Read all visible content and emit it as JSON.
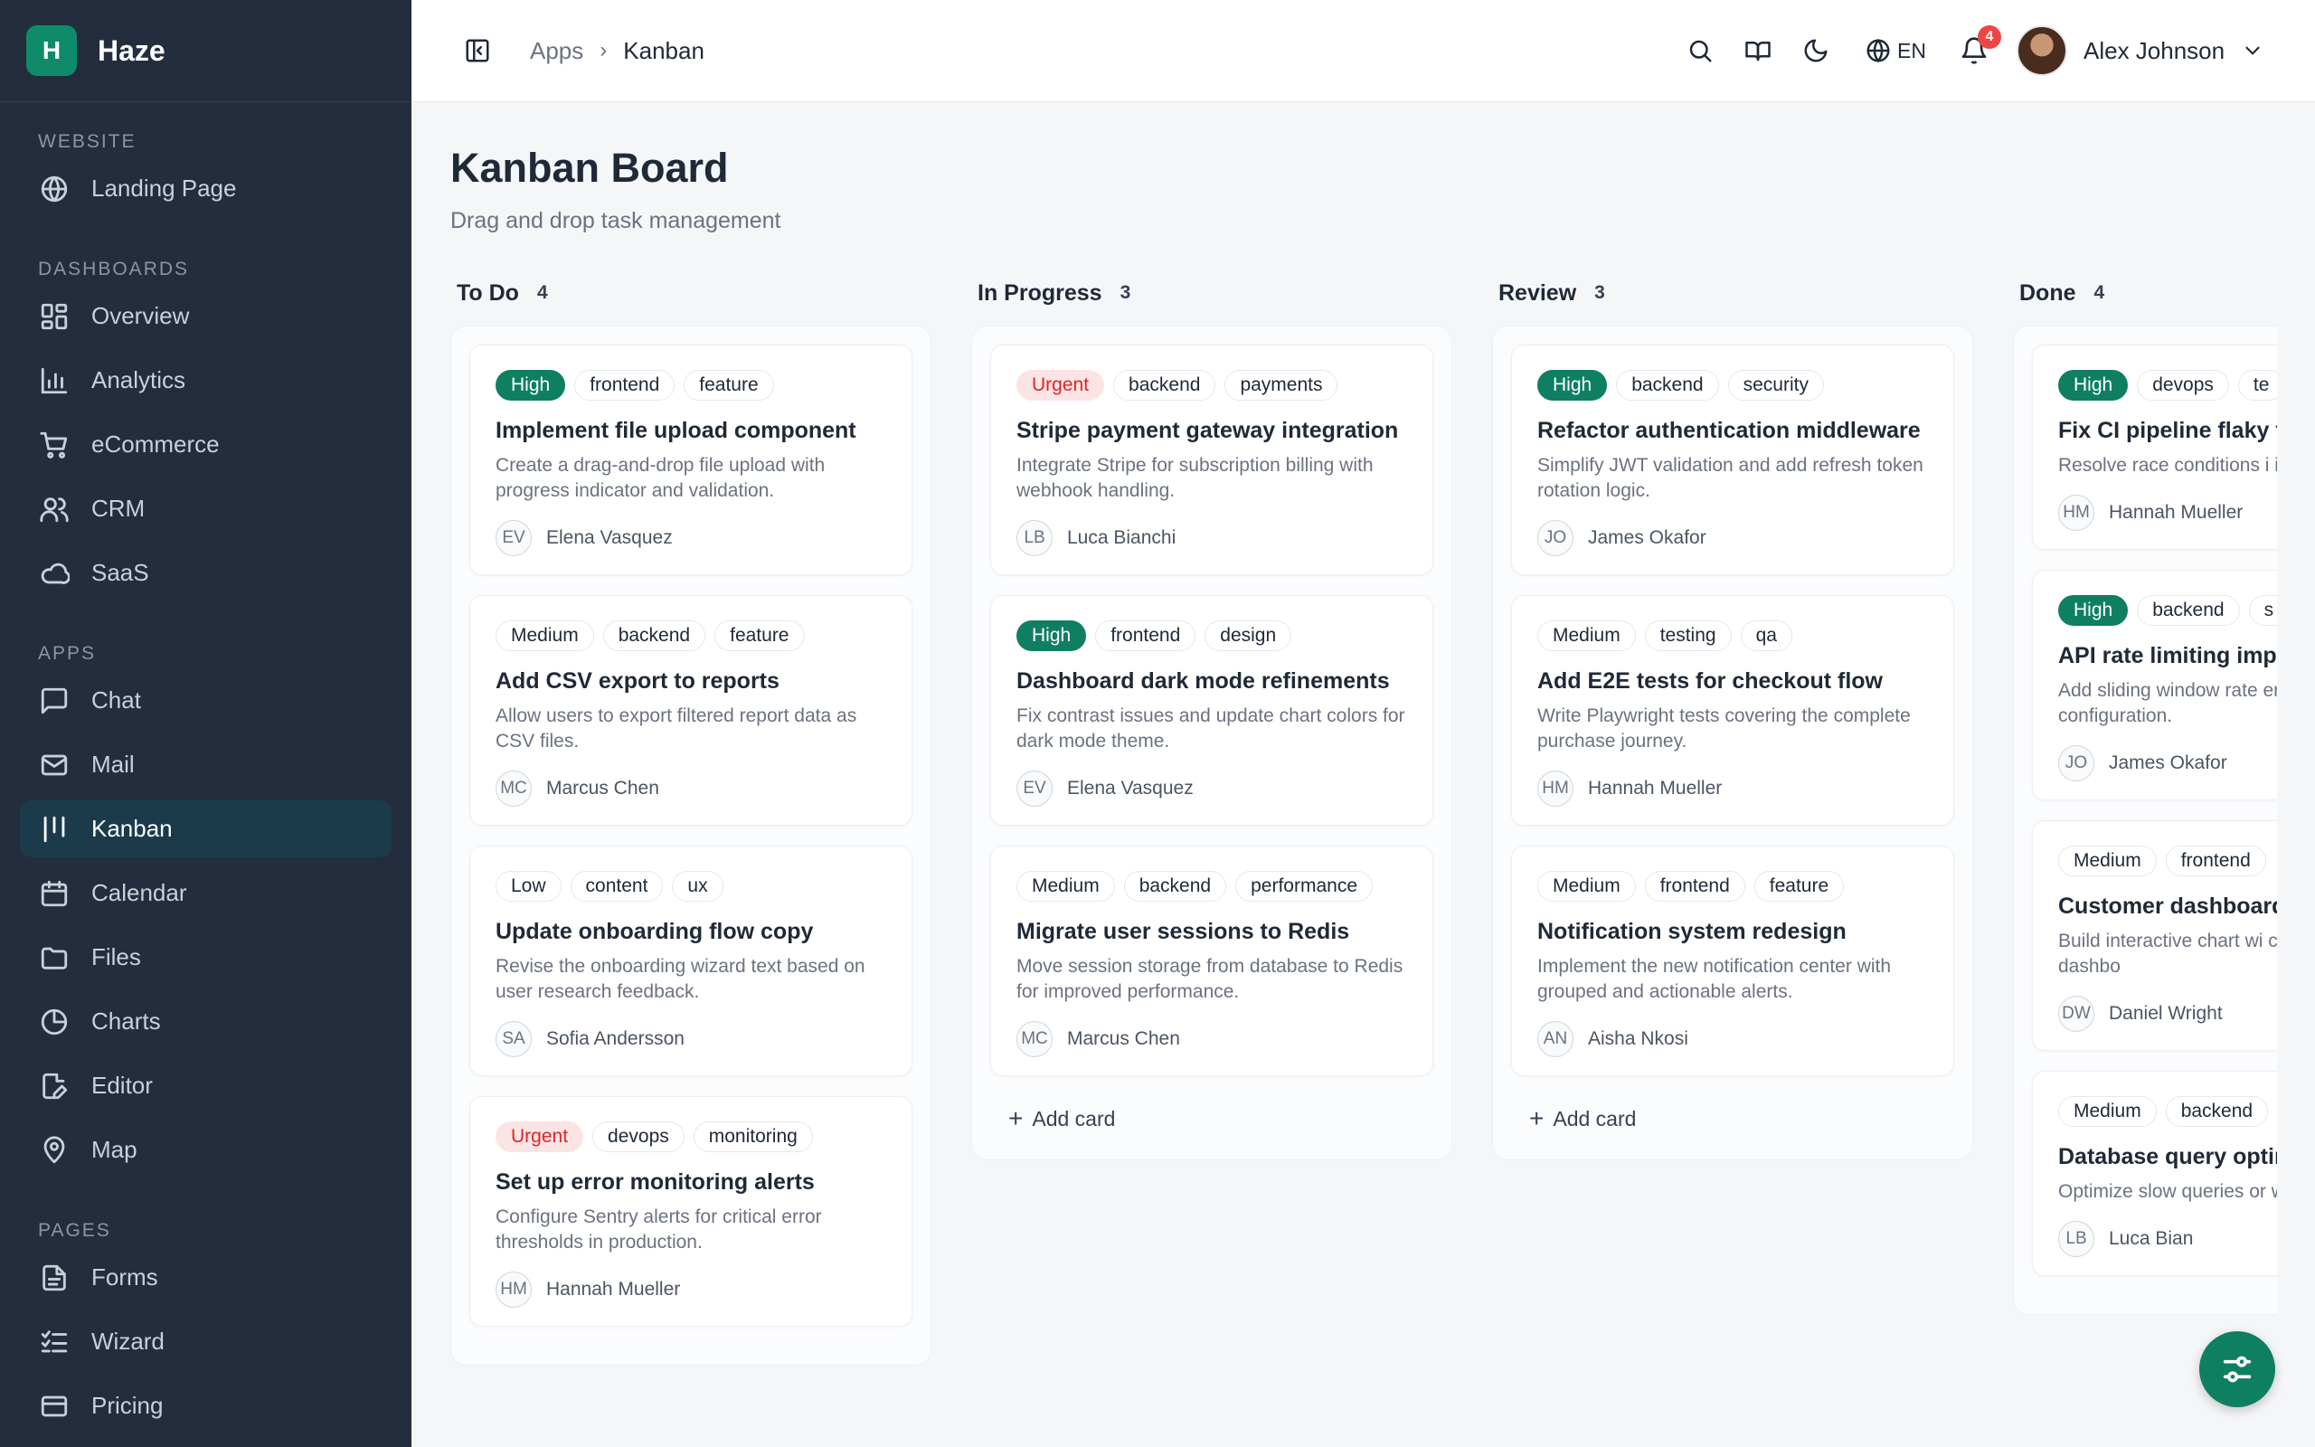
{
  "brand": {
    "logo": "H",
    "name": "Haze"
  },
  "sidebar": {
    "sections": [
      {
        "title": "WEBSITE",
        "items": [
          {
            "label": "Landing Page",
            "icon": "globe-icon"
          }
        ]
      },
      {
        "title": "DASHBOARDS",
        "items": [
          {
            "label": "Overview",
            "icon": "grid-icon"
          },
          {
            "label": "Analytics",
            "icon": "bar-chart-icon"
          },
          {
            "label": "eCommerce",
            "icon": "cart-icon"
          },
          {
            "label": "CRM",
            "icon": "users-icon"
          },
          {
            "label": "SaaS",
            "icon": "cloud-icon"
          }
        ]
      },
      {
        "title": "APPS",
        "items": [
          {
            "label": "Chat",
            "icon": "chat-icon"
          },
          {
            "label": "Mail",
            "icon": "mail-icon"
          },
          {
            "label": "Kanban",
            "icon": "kanban-icon",
            "active": true
          },
          {
            "label": "Calendar",
            "icon": "calendar-icon"
          },
          {
            "label": "Files",
            "icon": "folder-icon"
          },
          {
            "label": "Charts",
            "icon": "pie-chart-icon"
          },
          {
            "label": "Editor",
            "icon": "edit-icon"
          },
          {
            "label": "Map",
            "icon": "map-pin-icon"
          }
        ]
      },
      {
        "title": "PAGES",
        "items": [
          {
            "label": "Forms",
            "icon": "file-text-icon"
          },
          {
            "label": "Wizard",
            "icon": "checklist-icon"
          },
          {
            "label": "Pricing",
            "icon": "credit-card-icon"
          }
        ]
      }
    ]
  },
  "header": {
    "breadcrumb": {
      "root": "Apps",
      "current": "Kanban"
    },
    "language": "EN",
    "notifications_count": "4",
    "user_name": "Alex Johnson"
  },
  "page": {
    "title": "Kanban Board",
    "subtitle": "Drag and drop task management"
  },
  "board": {
    "add_card_label": "Add card",
    "columns": [
      {
        "title": "To Do",
        "count": "4",
        "cards": [
          {
            "tags": [
              "High",
              "frontend",
              "feature"
            ],
            "title": "Implement file upload component",
            "desc": "Create a drag-and-drop file upload with progress indicator and validation.",
            "initials": "EV",
            "assignee": "Elena Vasquez"
          },
          {
            "tags": [
              "Medium",
              "backend",
              "feature"
            ],
            "title": "Add CSV export to reports",
            "desc": "Allow users to export filtered report data as CSV files.",
            "initials": "MC",
            "assignee": "Marcus Chen"
          },
          {
            "tags": [
              "Low",
              "content",
              "ux"
            ],
            "title": "Update onboarding flow copy",
            "desc": "Revise the onboarding wizard text based on user research feedback.",
            "initials": "SA",
            "assignee": "Sofia Andersson"
          },
          {
            "tags": [
              "Urgent",
              "devops",
              "monitoring"
            ],
            "title": "Set up error monitoring alerts",
            "desc": "Configure Sentry alerts for critical error thresholds in production.",
            "initials": "HM",
            "assignee": "Hannah Mueller"
          }
        ]
      },
      {
        "title": "In Progress",
        "count": "3",
        "cards": [
          {
            "tags": [
              "Urgent",
              "backend",
              "payments"
            ],
            "title": "Stripe payment gateway integration",
            "desc": "Integrate Stripe for subscription billing with webhook handling.",
            "initials": "LB",
            "assignee": "Luca Bianchi"
          },
          {
            "tags": [
              "High",
              "frontend",
              "design"
            ],
            "title": "Dashboard dark mode refinements",
            "desc": "Fix contrast issues and update chart colors for dark mode theme.",
            "initials": "EV",
            "assignee": "Elena Vasquez"
          },
          {
            "tags": [
              "Medium",
              "backend",
              "performance"
            ],
            "title": "Migrate user sessions to Redis",
            "desc": "Move session storage from database to Redis for improved performance.",
            "initials": "MC",
            "assignee": "Marcus Chen"
          }
        ]
      },
      {
        "title": "Review",
        "count": "3",
        "cards": [
          {
            "tags": [
              "High",
              "backend",
              "security"
            ],
            "title": "Refactor authentication middleware",
            "desc": "Simplify JWT validation and add refresh token rotation logic.",
            "initials": "JO",
            "assignee": "James Okafor"
          },
          {
            "tags": [
              "Medium",
              "testing",
              "qa"
            ],
            "title": "Add E2E tests for checkout flow",
            "desc": "Write Playwright tests covering the complete purchase journey.",
            "initials": "HM",
            "assignee": "Hannah Mueller"
          },
          {
            "tags": [
              "Medium",
              "frontend",
              "feature"
            ],
            "title": "Notification system redesign",
            "desc": "Implement the new notification center with grouped and actionable alerts.",
            "initials": "AN",
            "assignee": "Aisha Nkosi"
          }
        ]
      },
      {
        "title": "Done",
        "count": "4",
        "cards": [
          {
            "tags": [
              "High",
              "devops",
              "te"
            ],
            "title": "Fix CI pipeline flaky t",
            "desc": "Resolve race conditions i integration tests.",
            "initials": "HM",
            "assignee": "Hannah Mueller"
          },
          {
            "tags": [
              "High",
              "backend",
              "s"
            ],
            "title": "API rate limiting impl",
            "desc": "Add sliding window rate endpoint configuration.",
            "initials": "JO",
            "assignee": "James Okafor"
          },
          {
            "tags": [
              "Medium",
              "frontend"
            ],
            "title": "Customer dashboard widgets",
            "desc": "Build interactive chart wi customer-facing dashbo",
            "initials": "DW",
            "assignee": "Daniel Wright"
          },
          {
            "tags": [
              "Medium",
              "backend"
            ],
            "title": "Database query optir",
            "desc": "Optimize slow queries or with proper indexing.",
            "initials": "LB",
            "assignee": "Luca Bian"
          }
        ]
      }
    ]
  },
  "colors": {
    "accent": "#0f7f62",
    "sidebar_bg": "#232d3d",
    "urgent": "#dc2626",
    "badge": "#ef4444"
  }
}
